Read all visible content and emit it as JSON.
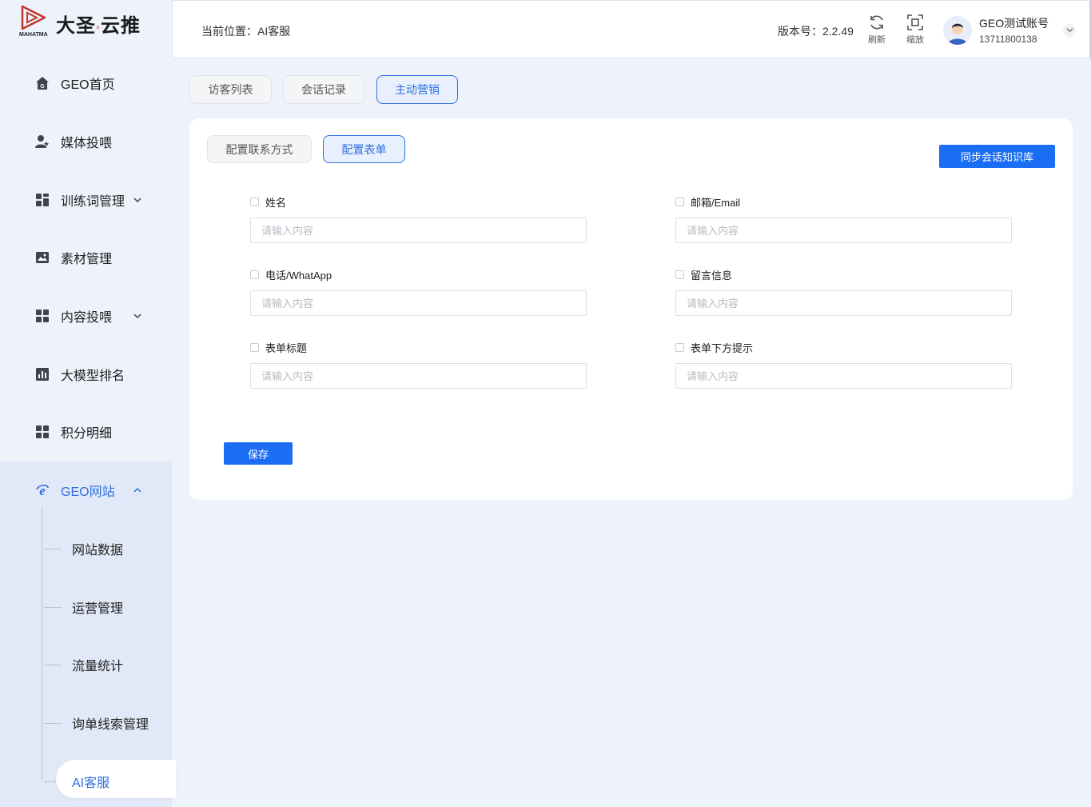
{
  "brand": {
    "name_part1": "大圣",
    "name_part2": "云推",
    "sub": "MAHATMA",
    "accent": "#c0392b"
  },
  "sidebar": {
    "items": [
      {
        "label": "GEO首页",
        "icon": "home-icon"
      },
      {
        "label": "媒体投喂",
        "icon": "user-star-icon"
      },
      {
        "label": "训练词管理",
        "icon": "grid-icon",
        "expandable": true
      },
      {
        "label": "素材管理",
        "icon": "image-icon"
      },
      {
        "label": "内容投喂",
        "icon": "grid-icon",
        "expandable": true
      },
      {
        "label": "大模型排名",
        "icon": "bar-chart-icon"
      },
      {
        "label": "积分明细",
        "icon": "grid-icon"
      }
    ],
    "group": {
      "label": "GEO网站",
      "icon": "ie-icon",
      "children": [
        "网站数据",
        "运营管理",
        "流量统计",
        "询单线索管理",
        "AI客服"
      ],
      "active_child": "AI客服"
    }
  },
  "header": {
    "breadcrumb": "当前位置：AI客服",
    "version": "版本号：2.2.49",
    "refresh_label": "刷新",
    "zoom_label": "缩放",
    "user_name": "GEO测试账号",
    "user_phone": "13711800138"
  },
  "tabs": [
    "访客列表",
    "会话记录",
    "主动营销"
  ],
  "active_tab": "主动营销",
  "card": {
    "subtabs": [
      "配置联系方式",
      "配置表单"
    ],
    "active_subtab": "配置表单",
    "sync_button": "同步会话知识库",
    "fields": [
      {
        "label": "姓名",
        "placeholder": "请输入内容",
        "value": "",
        "checked": false
      },
      {
        "label": "邮箱/Email",
        "placeholder": "请输入内容",
        "value": "",
        "checked": false
      },
      {
        "label": "电话/WhatApp",
        "placeholder": "请输入内容",
        "value": "",
        "checked": false
      },
      {
        "label": "留言信息",
        "placeholder": "请输入内容",
        "value": "",
        "checked": false
      },
      {
        "label": "表单标题",
        "placeholder": "请输入内容",
        "value": "",
        "checked": false
      },
      {
        "label": "表单下方提示",
        "placeholder": "请输入内容",
        "value": "",
        "checked": false
      }
    ],
    "save_button": "保存"
  },
  "colors": {
    "primary": "#1b6ef3",
    "active_text": "#2f6fe0",
    "background": "#eef2fb"
  }
}
